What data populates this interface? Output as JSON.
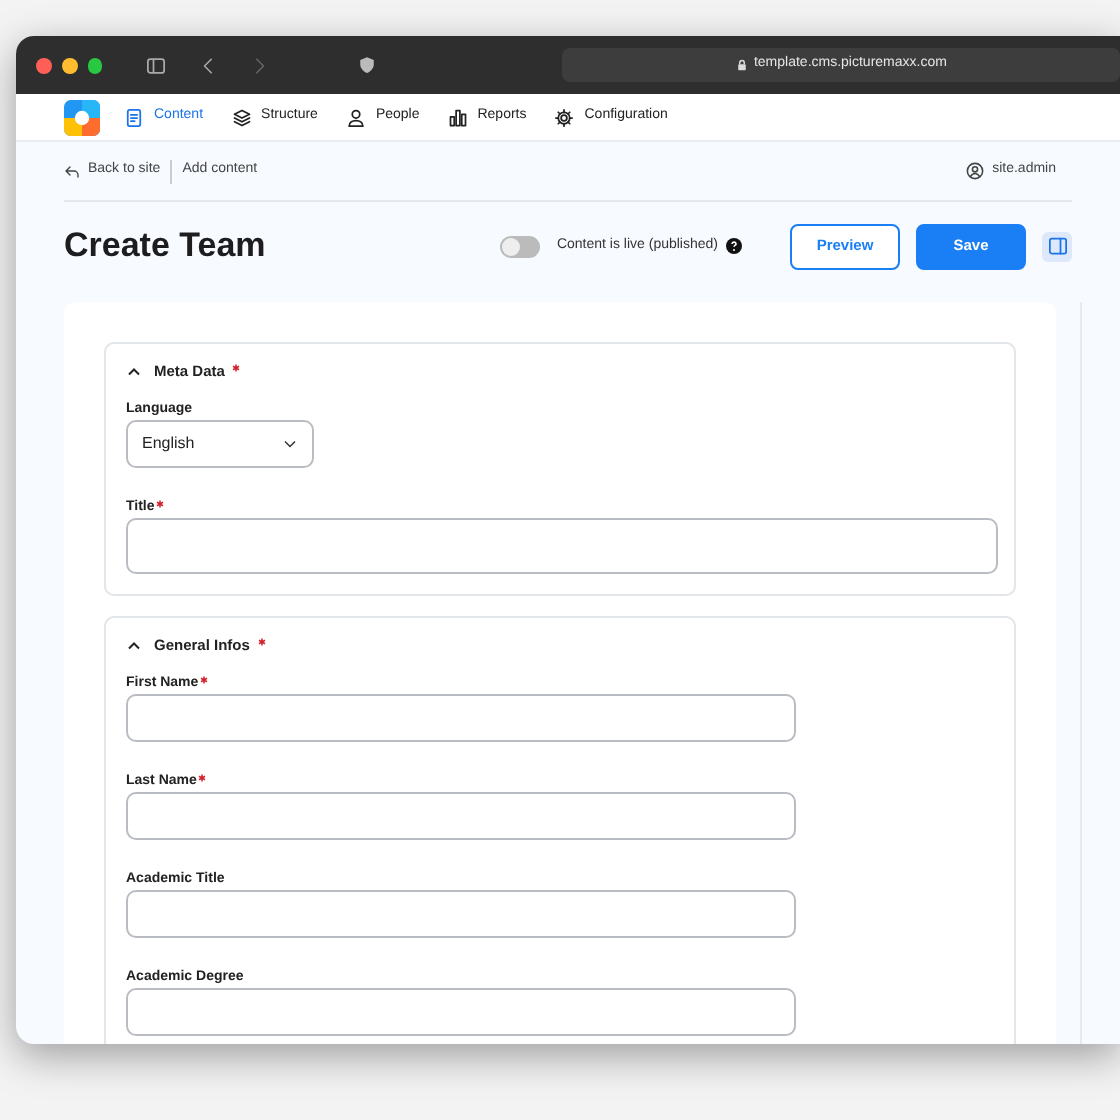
{
  "browser": {
    "url": "template.cms.picturemaxx.com"
  },
  "nav": [
    {
      "label": "Content",
      "selected": true
    },
    {
      "label": "Structure",
      "selected": false
    },
    {
      "label": "People",
      "selected": false
    },
    {
      "label": "Reports",
      "selected": false
    },
    {
      "label": "Configuration",
      "selected": false
    }
  ],
  "breadcrumb": {
    "back": "Back to site",
    "current": "Add content"
  },
  "user": "site.admin",
  "page": {
    "title": "Create Team",
    "publish_toggle": {
      "label": "Content is live (published)",
      "on": false
    },
    "buttons": [
      {
        "label": "Preview",
        "kind": "outline"
      },
      {
        "label": "Save",
        "kind": "primary"
      }
    ]
  },
  "sections": [
    {
      "title": "Meta Data",
      "required": true,
      "expanded": true,
      "fields": [
        {
          "label": "Language",
          "required": false,
          "kind": "select",
          "value": "English"
        },
        {
          "label": "Title",
          "required": true,
          "kind": "wide"
        }
      ]
    },
    {
      "title": "General Infos",
      "required": true,
      "expanded": true,
      "fields": [
        {
          "label": "First Name",
          "required": true,
          "kind": "text"
        },
        {
          "label": "Last Name",
          "required": true,
          "kind": "text"
        },
        {
          "label": "Academic Title",
          "required": false,
          "kind": "text"
        },
        {
          "label": "Academic Degree",
          "required": false,
          "kind": "text"
        }
      ]
    }
  ]
}
